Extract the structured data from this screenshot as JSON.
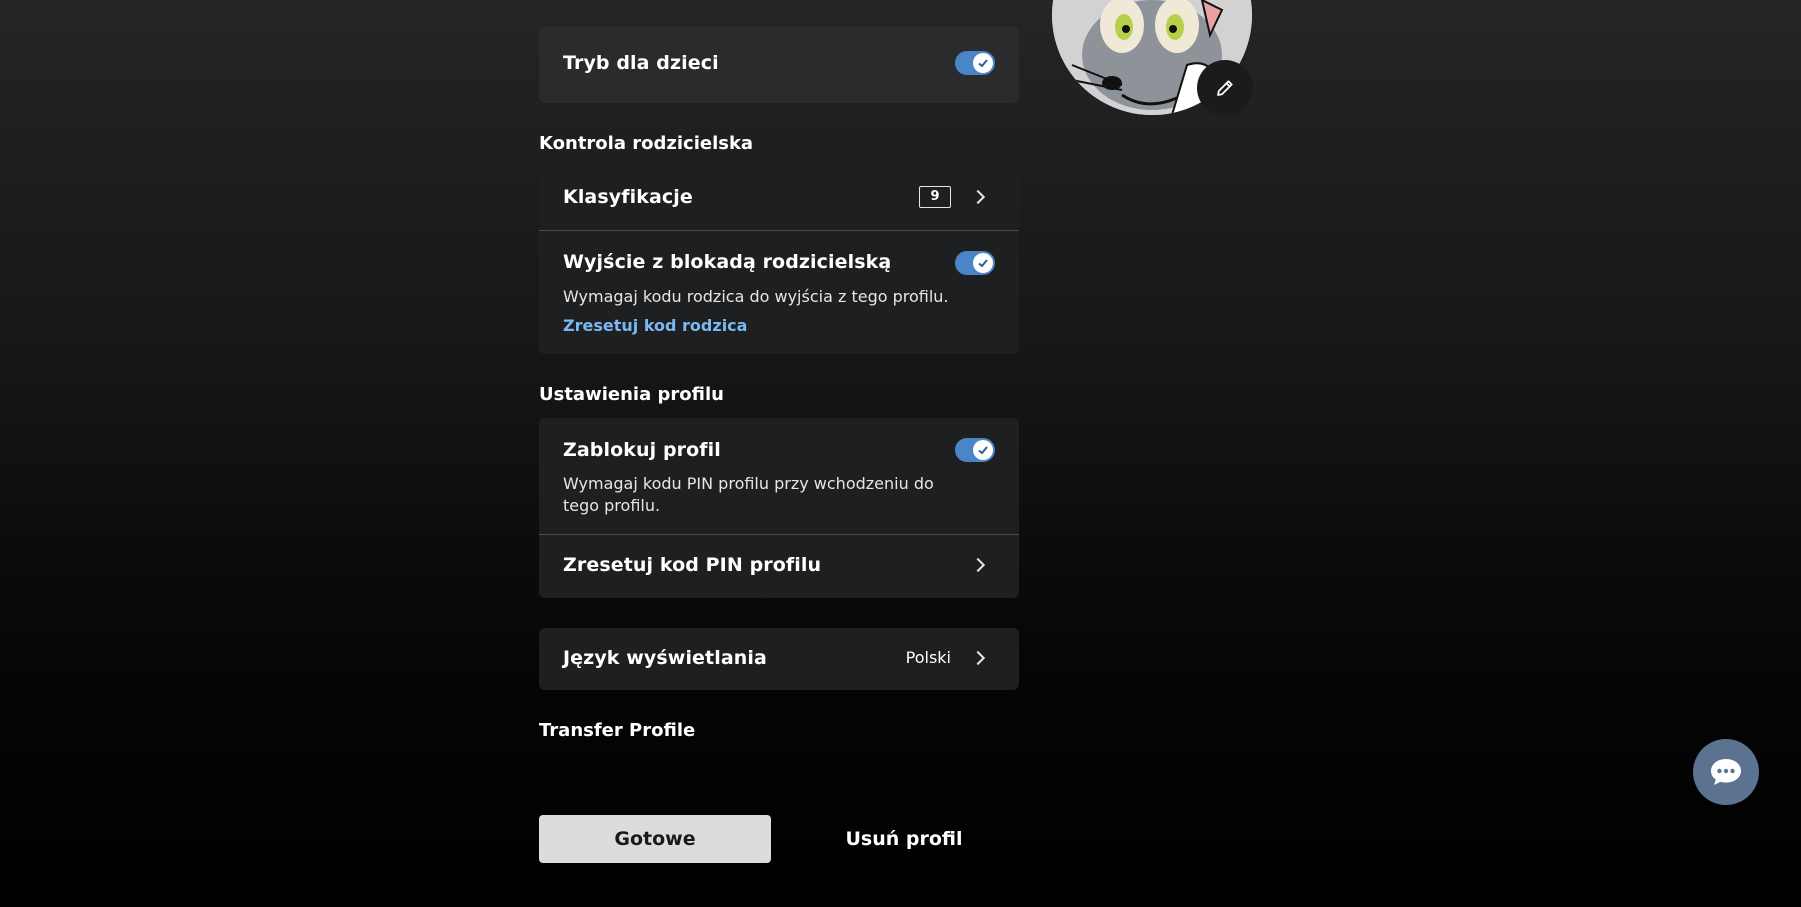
{
  "kids_mode": {
    "label": "Tryb dla dzieci",
    "enabled": true
  },
  "parental_controls": {
    "heading": "Kontrola rodzicielska",
    "ratings": {
      "label": "Klasyfikacje",
      "value": "9"
    },
    "exit_lock": {
      "label": "Wyjście z blokadą rodzicielską",
      "enabled": true,
      "description": "Wymagaj kodu rodzica do wyjścia z tego profilu.",
      "reset_link": "Zresetuj kod rodzica"
    }
  },
  "profile_settings": {
    "heading": "Ustawienia profilu",
    "lock_profile": {
      "label": "Zablokuj profil",
      "enabled": true,
      "description": "Wymagaj kodu PIN profilu przy wchodzeniu do tego profilu."
    },
    "reset_pin": {
      "label": "Zresetuj kod PIN profilu"
    }
  },
  "display_language": {
    "label": "Język wyświetlania",
    "value": "Polski"
  },
  "transfer_profile": {
    "heading": "Transfer Profile"
  },
  "actions": {
    "done": "Gotowe",
    "delete": "Usuń profil"
  },
  "icons": {
    "edit": "pencil-icon",
    "chat": "chat-bubble-icon",
    "chevron": "chevron-right-icon",
    "check": "check-icon"
  },
  "colors": {
    "toggle_on": "#4a86c7",
    "link": "#79b8f3",
    "card": "#1e1f21",
    "primary_button": "#dcdcdc",
    "chat_button": "#5b7290"
  }
}
